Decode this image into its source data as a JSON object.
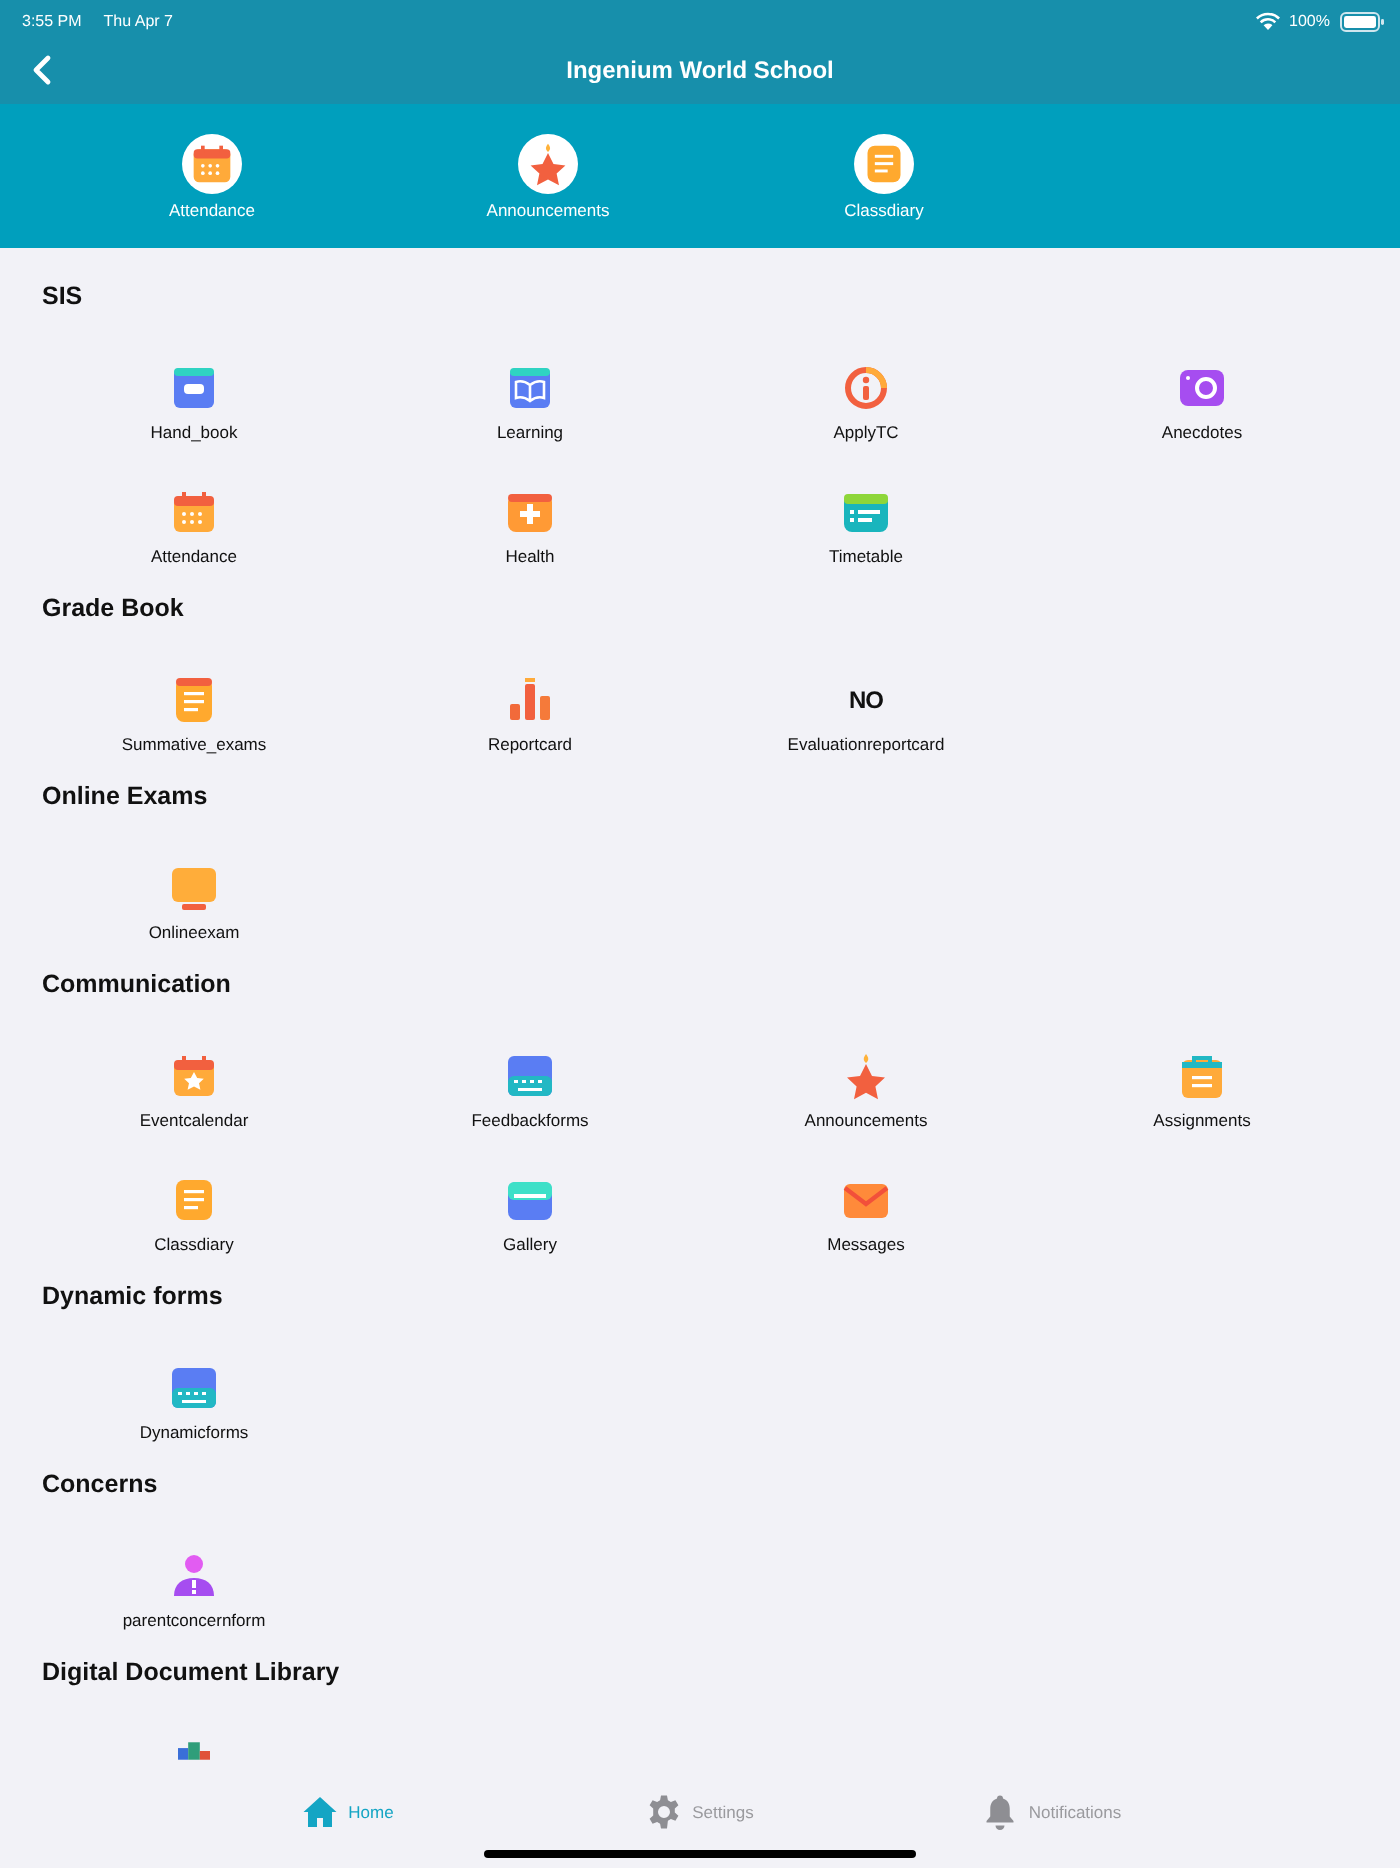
{
  "status_bar": {
    "time": "3:55 PM",
    "date": "Thu Apr 7",
    "battery": "100%"
  },
  "nav": {
    "title": "Ingenium World School"
  },
  "quick_links": [
    {
      "label": "Attendance",
      "kind": "calendar"
    },
    {
      "label": "Announcements",
      "kind": "star"
    },
    {
      "label": "Classdiary",
      "kind": "note"
    }
  ],
  "sections": [
    {
      "title": "SIS",
      "items": [
        {
          "label": "Hand_book",
          "kind": "handbook"
        },
        {
          "label": "Learning",
          "kind": "book"
        },
        {
          "label": "ApplyTC",
          "kind": "info"
        },
        {
          "label": "Anecdotes",
          "kind": "camera"
        },
        {
          "label": "Attendance",
          "kind": "calendar"
        },
        {
          "label": "Health",
          "kind": "health"
        },
        {
          "label": "Timetable",
          "kind": "timetable"
        }
      ]
    },
    {
      "title": "Grade Book",
      "items": [
        {
          "label": "Summative_exams",
          "kind": "doc"
        },
        {
          "label": "Reportcard",
          "kind": "bars"
        },
        {
          "label": "Evaluationreportcard",
          "kind": "noimage",
          "icon_text": "NO"
        }
      ]
    },
    {
      "title": "Online Exams",
      "items": [
        {
          "label": "Onlineexam",
          "kind": "monitor"
        }
      ]
    },
    {
      "title": "Communication",
      "items": [
        {
          "label": "Eventcalendar",
          "kind": "event"
        },
        {
          "label": "Feedbackforms",
          "kind": "keyboard"
        },
        {
          "label": "Announcements",
          "kind": "star"
        },
        {
          "label": "Assignments",
          "kind": "clipboard"
        },
        {
          "label": "Classdiary",
          "kind": "note"
        },
        {
          "label": "Gallery",
          "kind": "gallery"
        },
        {
          "label": "Messages",
          "kind": "mail"
        }
      ]
    },
    {
      "title": "Dynamic forms",
      "items": [
        {
          "label": "Dynamicforms",
          "kind": "keyboard"
        }
      ]
    },
    {
      "title": "Concerns",
      "items": [
        {
          "label": "parentconcernform",
          "kind": "person"
        }
      ]
    },
    {
      "title": "Digital Document Library",
      "items": [
        {
          "kind": "books"
        }
      ]
    }
  ],
  "tab_bar": [
    {
      "label": "Home",
      "kind": "home",
      "selected": true
    },
    {
      "label": "Settings",
      "kind": "gear",
      "selected": false
    },
    {
      "label": "Notifications",
      "kind": "bell",
      "selected": false
    }
  ]
}
